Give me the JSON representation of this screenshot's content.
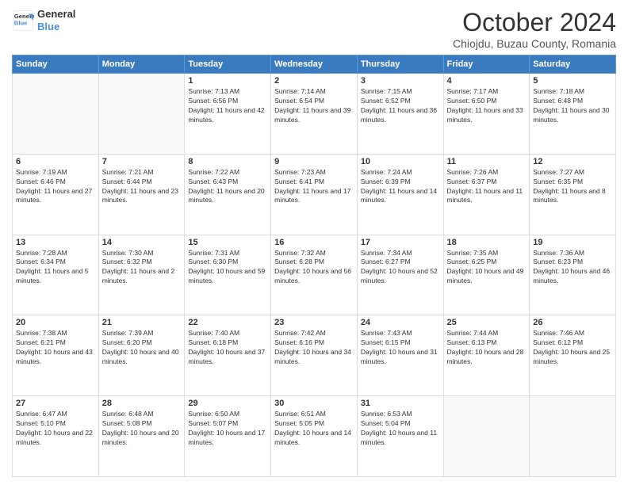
{
  "header": {
    "logo_line1": "General",
    "logo_line2": "Blue",
    "month": "October 2024",
    "location": "Chiojdu, Buzau County, Romania"
  },
  "weekdays": [
    "Sunday",
    "Monday",
    "Tuesday",
    "Wednesday",
    "Thursday",
    "Friday",
    "Saturday"
  ],
  "weeks": [
    [
      {
        "day": "",
        "sunrise": "",
        "sunset": "",
        "daylight": ""
      },
      {
        "day": "",
        "sunrise": "",
        "sunset": "",
        "daylight": ""
      },
      {
        "day": "1",
        "sunrise": "Sunrise: 7:13 AM",
        "sunset": "Sunset: 6:56 PM",
        "daylight": "Daylight: 11 hours and 42 minutes."
      },
      {
        "day": "2",
        "sunrise": "Sunrise: 7:14 AM",
        "sunset": "Sunset: 6:54 PM",
        "daylight": "Daylight: 11 hours and 39 minutes."
      },
      {
        "day": "3",
        "sunrise": "Sunrise: 7:15 AM",
        "sunset": "Sunset: 6:52 PM",
        "daylight": "Daylight: 11 hours and 36 minutes."
      },
      {
        "day": "4",
        "sunrise": "Sunrise: 7:17 AM",
        "sunset": "Sunset: 6:50 PM",
        "daylight": "Daylight: 11 hours and 33 minutes."
      },
      {
        "day": "5",
        "sunrise": "Sunrise: 7:18 AM",
        "sunset": "Sunset: 6:48 PM",
        "daylight": "Daylight: 11 hours and 30 minutes."
      }
    ],
    [
      {
        "day": "6",
        "sunrise": "Sunrise: 7:19 AM",
        "sunset": "Sunset: 6:46 PM",
        "daylight": "Daylight: 11 hours and 27 minutes."
      },
      {
        "day": "7",
        "sunrise": "Sunrise: 7:21 AM",
        "sunset": "Sunset: 6:44 PM",
        "daylight": "Daylight: 11 hours and 23 minutes."
      },
      {
        "day": "8",
        "sunrise": "Sunrise: 7:22 AM",
        "sunset": "Sunset: 6:43 PM",
        "daylight": "Daylight: 11 hours and 20 minutes."
      },
      {
        "day": "9",
        "sunrise": "Sunrise: 7:23 AM",
        "sunset": "Sunset: 6:41 PM",
        "daylight": "Daylight: 11 hours and 17 minutes."
      },
      {
        "day": "10",
        "sunrise": "Sunrise: 7:24 AM",
        "sunset": "Sunset: 6:39 PM",
        "daylight": "Daylight: 11 hours and 14 minutes."
      },
      {
        "day": "11",
        "sunrise": "Sunrise: 7:26 AM",
        "sunset": "Sunset: 6:37 PM",
        "daylight": "Daylight: 11 hours and 11 minutes."
      },
      {
        "day": "12",
        "sunrise": "Sunrise: 7:27 AM",
        "sunset": "Sunset: 6:35 PM",
        "daylight": "Daylight: 11 hours and 8 minutes."
      }
    ],
    [
      {
        "day": "13",
        "sunrise": "Sunrise: 7:28 AM",
        "sunset": "Sunset: 6:34 PM",
        "daylight": "Daylight: 11 hours and 5 minutes."
      },
      {
        "day": "14",
        "sunrise": "Sunrise: 7:30 AM",
        "sunset": "Sunset: 6:32 PM",
        "daylight": "Daylight: 11 hours and 2 minutes."
      },
      {
        "day": "15",
        "sunrise": "Sunrise: 7:31 AM",
        "sunset": "Sunset: 6:30 PM",
        "daylight": "Daylight: 10 hours and 59 minutes."
      },
      {
        "day": "16",
        "sunrise": "Sunrise: 7:32 AM",
        "sunset": "Sunset: 6:28 PM",
        "daylight": "Daylight: 10 hours and 56 minutes."
      },
      {
        "day": "17",
        "sunrise": "Sunrise: 7:34 AM",
        "sunset": "Sunset: 6:27 PM",
        "daylight": "Daylight: 10 hours and 52 minutes."
      },
      {
        "day": "18",
        "sunrise": "Sunrise: 7:35 AM",
        "sunset": "Sunset: 6:25 PM",
        "daylight": "Daylight: 10 hours and 49 minutes."
      },
      {
        "day": "19",
        "sunrise": "Sunrise: 7:36 AM",
        "sunset": "Sunset: 6:23 PM",
        "daylight": "Daylight: 10 hours and 46 minutes."
      }
    ],
    [
      {
        "day": "20",
        "sunrise": "Sunrise: 7:38 AM",
        "sunset": "Sunset: 6:21 PM",
        "daylight": "Daylight: 10 hours and 43 minutes."
      },
      {
        "day": "21",
        "sunrise": "Sunrise: 7:39 AM",
        "sunset": "Sunset: 6:20 PM",
        "daylight": "Daylight: 10 hours and 40 minutes."
      },
      {
        "day": "22",
        "sunrise": "Sunrise: 7:40 AM",
        "sunset": "Sunset: 6:18 PM",
        "daylight": "Daylight: 10 hours and 37 minutes."
      },
      {
        "day": "23",
        "sunrise": "Sunrise: 7:42 AM",
        "sunset": "Sunset: 6:16 PM",
        "daylight": "Daylight: 10 hours and 34 minutes."
      },
      {
        "day": "24",
        "sunrise": "Sunrise: 7:43 AM",
        "sunset": "Sunset: 6:15 PM",
        "daylight": "Daylight: 10 hours and 31 minutes."
      },
      {
        "day": "25",
        "sunrise": "Sunrise: 7:44 AM",
        "sunset": "Sunset: 6:13 PM",
        "daylight": "Daylight: 10 hours and 28 minutes."
      },
      {
        "day": "26",
        "sunrise": "Sunrise: 7:46 AM",
        "sunset": "Sunset: 6:12 PM",
        "daylight": "Daylight: 10 hours and 25 minutes."
      }
    ],
    [
      {
        "day": "27",
        "sunrise": "Sunrise: 6:47 AM",
        "sunset": "Sunset: 5:10 PM",
        "daylight": "Daylight: 10 hours and 22 minutes."
      },
      {
        "day": "28",
        "sunrise": "Sunrise: 6:48 AM",
        "sunset": "Sunset: 5:08 PM",
        "daylight": "Daylight: 10 hours and 20 minutes."
      },
      {
        "day": "29",
        "sunrise": "Sunrise: 6:50 AM",
        "sunset": "Sunset: 5:07 PM",
        "daylight": "Daylight: 10 hours and 17 minutes."
      },
      {
        "day": "30",
        "sunrise": "Sunrise: 6:51 AM",
        "sunset": "Sunset: 5:05 PM",
        "daylight": "Daylight: 10 hours and 14 minutes."
      },
      {
        "day": "31",
        "sunrise": "Sunrise: 6:53 AM",
        "sunset": "Sunset: 5:04 PM",
        "daylight": "Daylight: 10 hours and 11 minutes."
      },
      {
        "day": "",
        "sunrise": "",
        "sunset": "",
        "daylight": ""
      },
      {
        "day": "",
        "sunrise": "",
        "sunset": "",
        "daylight": ""
      }
    ]
  ]
}
